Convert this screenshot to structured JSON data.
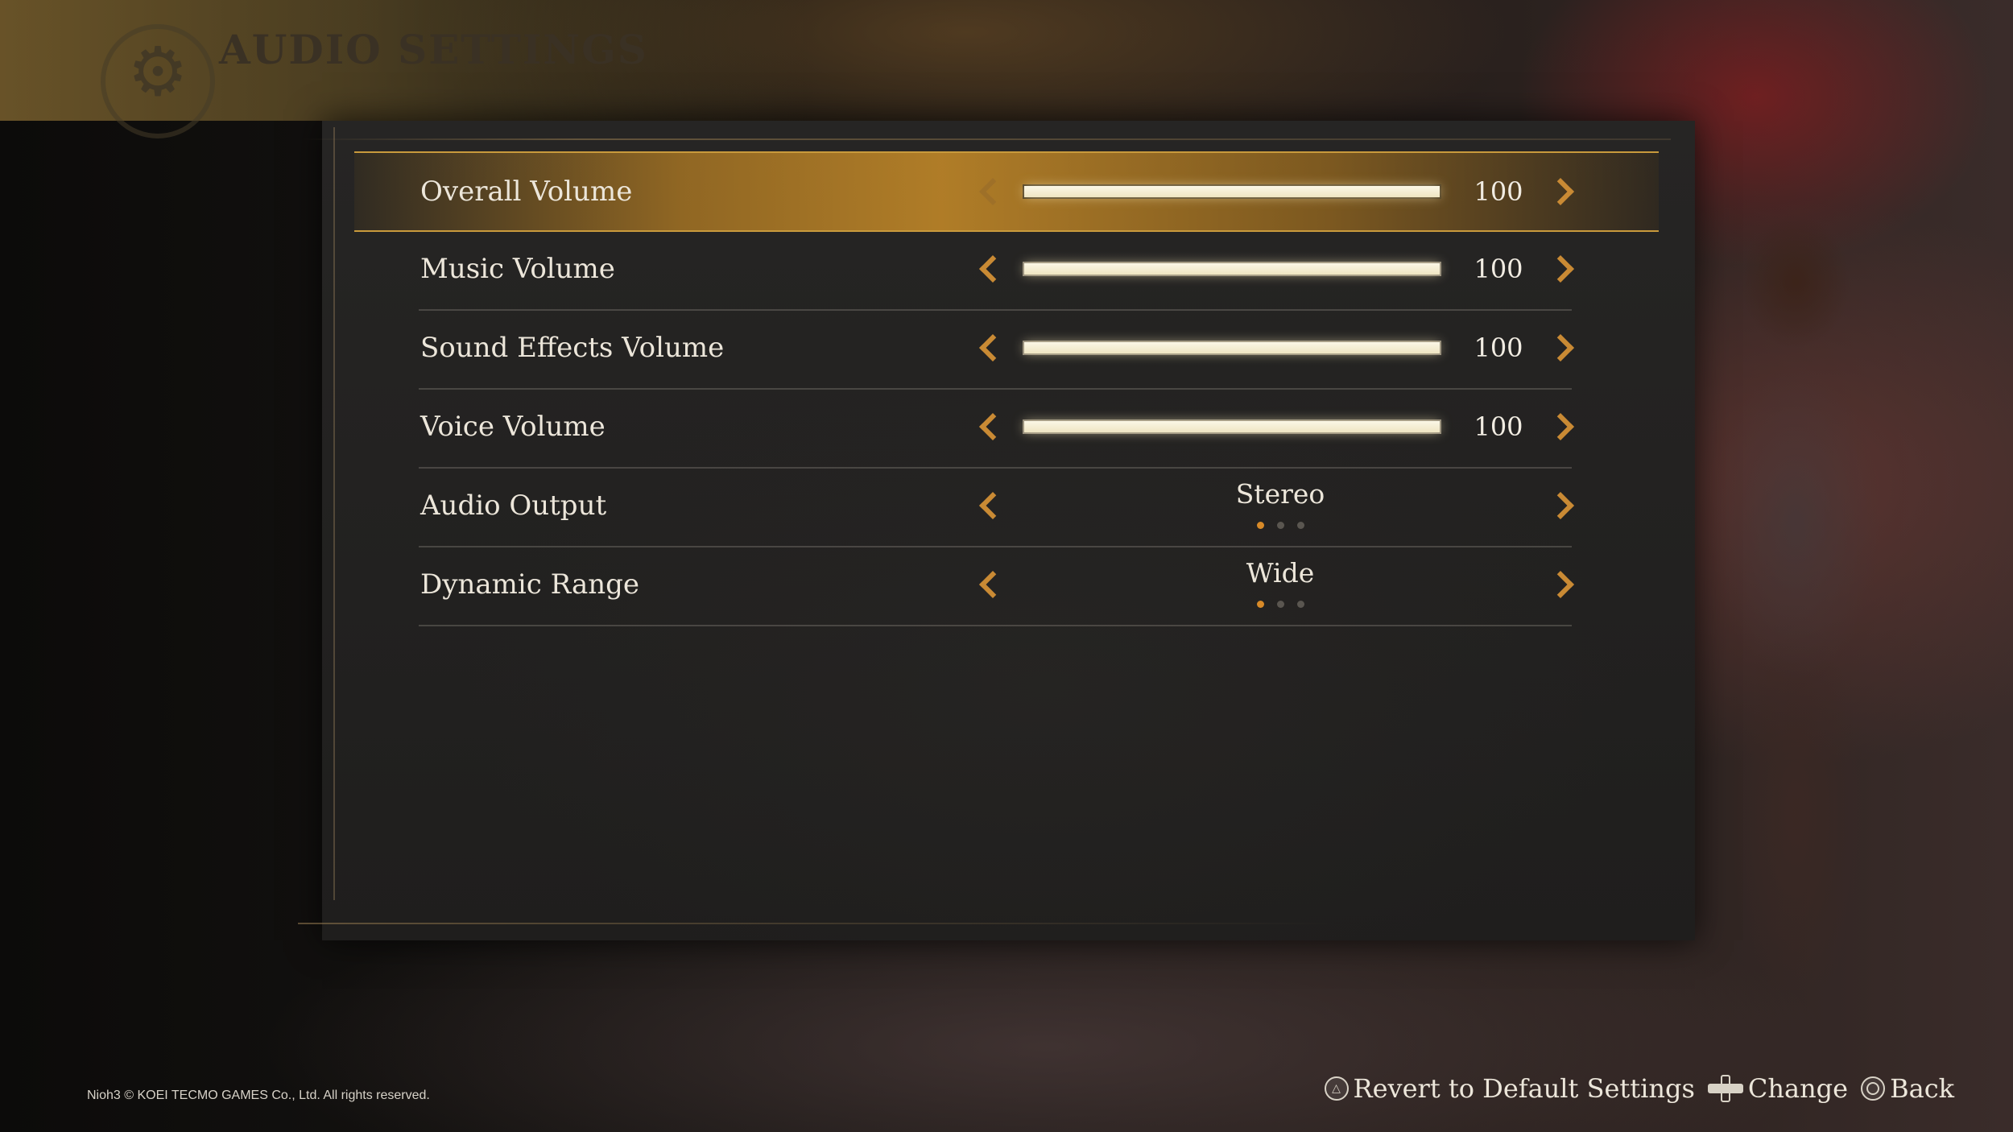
{
  "header": {
    "title": "AUDIO SETTINGS"
  },
  "settings": {
    "rows": [
      {
        "label": "Overall Volume",
        "type": "slider",
        "value": "100",
        "level": 1.0,
        "selected": true
      },
      {
        "label": "Music Volume",
        "type": "slider",
        "value": "100",
        "level": 1.0
      },
      {
        "label": "Sound Effects Volume",
        "type": "slider",
        "value": "100",
        "level": 1.0
      },
      {
        "label": "Voice Volume",
        "type": "slider",
        "value": "100",
        "level": 1.0
      },
      {
        "label": "Audio Output",
        "type": "option",
        "value": "Stereo",
        "option_index": 0,
        "option_count": 3
      },
      {
        "label": "Dynamic Range",
        "type": "option",
        "value": "Wide",
        "option_index": 0,
        "option_count": 3
      }
    ]
  },
  "footer": {
    "copyright": "Nioh3 © KOEI TECMO GAMES Co., Ltd. All rights reserved.",
    "hints": {
      "revert": "Revert to Default Settings",
      "change": "Change",
      "back": "Back"
    }
  },
  "colors": {
    "accent": "#c98a34",
    "selected_highlight": "#c99a3c",
    "dot_active": "#d88a28"
  }
}
